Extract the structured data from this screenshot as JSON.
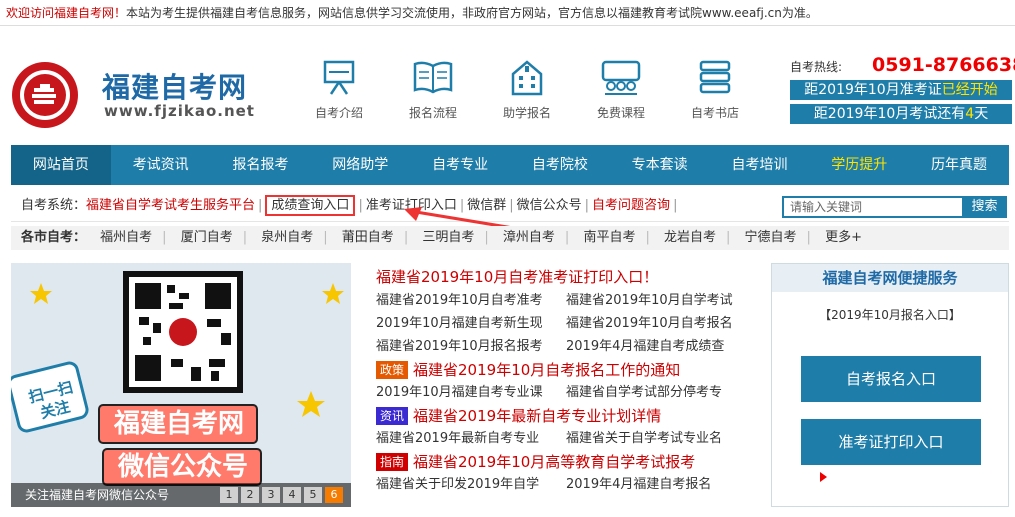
{
  "topbar": {
    "welcome": "欢迎访问福建自考网！",
    "notice": "本站为考生提供福建自考信息服务，网站信息供学习交流使用，非政府官方网站，官方信息以福建教育考试院www.eeafj.cn为准。"
  },
  "logo": {
    "name": "福建自考网",
    "domain": "www.fjzikao.net",
    "seal_text": "福建省人民政府教育考试院",
    "seal_date": "2012.07.01"
  },
  "nav_icons": [
    {
      "label": "自考介绍",
      "icon": "easel-icon"
    },
    {
      "label": "报名流程",
      "icon": "book-icon"
    },
    {
      "label": "助学报名",
      "icon": "building-icon"
    },
    {
      "label": "免费课程",
      "icon": "classroom-icon"
    },
    {
      "label": "自考书店",
      "icon": "books-stack-icon"
    }
  ],
  "hotline": {
    "label": "自考热线:",
    "phone": "0591-87666380",
    "box1_prefix": "距2019年10月准考证",
    "box1_status": "已经开始",
    "box2_prefix": "距2019年10月考试还有",
    "box2_days": "4",
    "box2_suffix": "天"
  },
  "main_nav": [
    "网站首页",
    "考试资讯",
    "报名报考",
    "网络助学",
    "自考专业",
    "自考院校",
    "专本套读",
    "自考培训",
    "学历提升",
    "历年真题"
  ],
  "sys_bar": {
    "label": "自考系统：",
    "platform": "福建省自学考试考生服务平台",
    "score": "成绩查询入口",
    "ticket": "准考证打印入口",
    "wechat_group": "微信群",
    "wechat_public": "微信公众号",
    "consult": "自考问题咨询"
  },
  "search": {
    "placeholder": "请输入关键词",
    "button": "搜索"
  },
  "city_bar": {
    "label": "各市自考：",
    "cities": [
      "福州自考",
      "厦门自考",
      "泉州自考",
      "莆田自考",
      "三明自考",
      "漳州自考",
      "南平自考",
      "龙岩自考",
      "宁德自考",
      "更多+"
    ]
  },
  "banner": {
    "title_line1": "福建自考网",
    "title_line2": "微信公众号",
    "scan_text1": "扫一扫",
    "scan_text2": "关注",
    "caption": "关注福建自考网微信公众号",
    "pages": [
      "1",
      "2",
      "3",
      "4",
      "5",
      "6"
    ],
    "active_page": "6"
  },
  "news": {
    "headline": "福建省2019年10月自考准考证打印入口！",
    "rows1": [
      [
        "福建省2019年10月自考准考",
        "福建省2019年10月自学考试"
      ],
      [
        "2019年10月福建自考新生现",
        "福建省2019年10月自考报名"
      ],
      [
        "福建省2019年10月报名报考",
        "2019年4月福建自考成绩查"
      ]
    ],
    "group2_tag": "政策",
    "group2_title": "福建省2019年10月自考报名工作的通知",
    "group2_row": [
      "2019年10月福建自考专业课",
      "福建省自学考试部分停考专"
    ],
    "group3_tag": "资讯",
    "group3_title": "福建省2019年最新自考专业计划详情",
    "group3_row": [
      "福建省2019年最新自考专业",
      "福建省关于自学考试专业名"
    ],
    "group4_tag": "指南",
    "group4_title": "福建省2019年10月高等教育自学考试报考",
    "group4_row": [
      "福建省关于印发2019年自学",
      "2019年4月福建自考报名"
    ]
  },
  "side": {
    "title": "福建自考网便捷服务",
    "sub": "【2019年10月报名入口】",
    "btn1": "自考报名入口",
    "btn2": "准考证打印入口"
  },
  "colors": {
    "brand_blue": "#1f7ea9",
    "accent_red": "#e00000",
    "highlight_yellow": "#ffe400",
    "tag_policy": "#e55a00",
    "tag_info": "#3b2ad1",
    "tag_guide": "#d10000"
  }
}
